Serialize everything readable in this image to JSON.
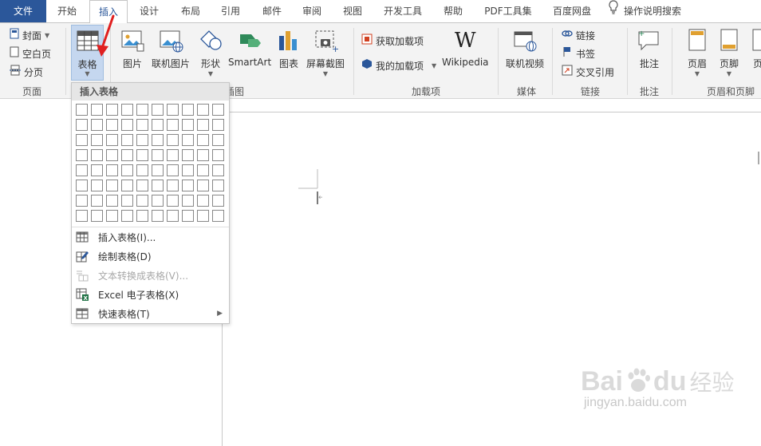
{
  "tabs": [
    {
      "label": "文件"
    },
    {
      "label": "开始"
    },
    {
      "label": "插入"
    },
    {
      "label": "设计"
    },
    {
      "label": "布局"
    },
    {
      "label": "引用"
    },
    {
      "label": "邮件"
    },
    {
      "label": "审阅"
    },
    {
      "label": "视图"
    },
    {
      "label": "开发工具"
    },
    {
      "label": "帮助"
    },
    {
      "label": "PDF工具集"
    },
    {
      "label": "百度网盘"
    }
  ],
  "tell_me": "操作说明搜索",
  "ribbon": {
    "pages": {
      "cover": "封面",
      "blank": "空白页",
      "break": "分页",
      "group": "页面"
    },
    "table": {
      "label": "表格"
    },
    "illustrations": {
      "picture": "图片",
      "online_picture": "联机图片",
      "shapes": "形状",
      "smartart": "SmartArt",
      "chart": "图表",
      "screenshot": "屏幕截图",
      "group_tail": "插图"
    },
    "addins": {
      "get": "获取加载项",
      "mine": "我的加载项",
      "wikipedia": "Wikipedia",
      "group": "加载项"
    },
    "media": {
      "online_video": "联机视频",
      "group": "媒体"
    },
    "links": {
      "link": "链接",
      "bookmark": "书签",
      "cross_ref": "交叉引用",
      "group": "链接"
    },
    "comments": {
      "comment": "批注",
      "group": "批注"
    },
    "header_footer": {
      "header": "页眉",
      "footer": "页脚",
      "page_num": "页",
      "group": "页眉和页脚"
    }
  },
  "dropdown": {
    "title": "插入表格",
    "items": [
      {
        "label": "插入表格(I)..."
      },
      {
        "label": "绘制表格(D)"
      },
      {
        "label": "文本转换成表格(V)..."
      },
      {
        "label": "Excel 电子表格(X)"
      },
      {
        "label": "快速表格(T)"
      }
    ]
  },
  "watermark": {
    "brand": "Bai",
    "brand2": "du",
    "cn": "经验",
    "url": "jingyan.baidu.com"
  },
  "colors": {
    "file_tab": "#2b579a",
    "accent_arrow": "#e02020",
    "ribbon_bg": "#f3f3f3"
  }
}
